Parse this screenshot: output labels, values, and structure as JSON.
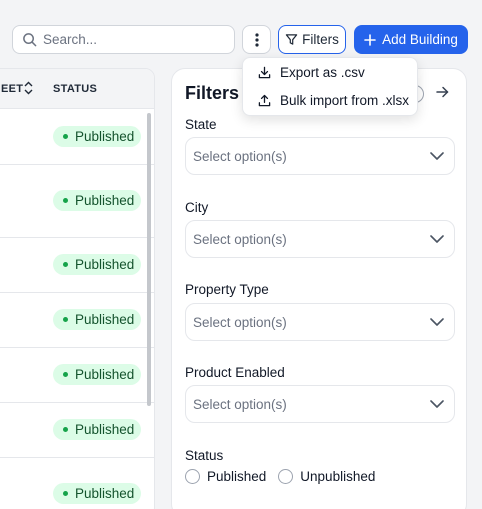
{
  "toolbar": {
    "search_placeholder": "Search...",
    "filters_label": "Filters",
    "add_label": "Add Building"
  },
  "table": {
    "prev_header_fragment": "EET",
    "status_header": "STATUS",
    "rows": [
      {
        "status": "Published"
      },
      {
        "status": "Published"
      },
      {
        "status": "Published"
      },
      {
        "status": "Published"
      },
      {
        "status": "Published"
      },
      {
        "status": "Published"
      },
      {
        "status": "Published"
      }
    ]
  },
  "export_menu": {
    "items": [
      {
        "label": "Export as .csv",
        "icon": "download-icon"
      },
      {
        "label": "Bulk import from .xlsx",
        "icon": "upload-icon"
      }
    ]
  },
  "filters_panel": {
    "title": "Filters",
    "fields": [
      {
        "label": "State",
        "placeholder": "Select option(s)"
      },
      {
        "label": "City",
        "placeholder": "Select option(s)"
      },
      {
        "label": "Property Type",
        "placeholder": "Select option(s)"
      },
      {
        "label": "Product Enabled",
        "placeholder": "Select option(s)"
      }
    ],
    "status": {
      "label": "Status",
      "options": [
        "Published",
        "Unpublished"
      ]
    }
  },
  "colors": {
    "primary": "#2563eb",
    "badge_bg": "#dcfce7",
    "badge_dot": "#16a34a"
  }
}
